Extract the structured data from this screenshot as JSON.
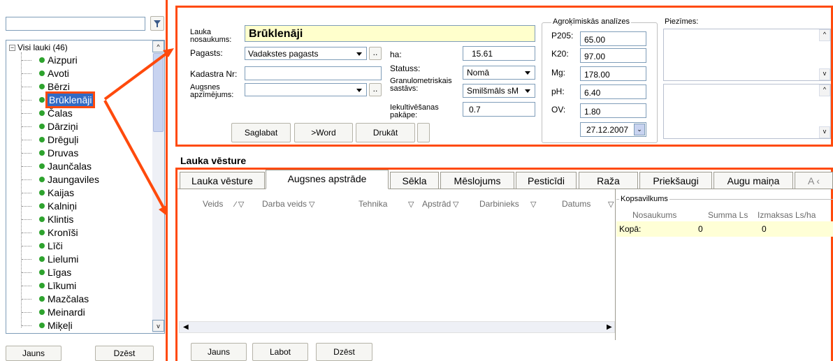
{
  "tree": {
    "filter_icon": "filter-icon",
    "root_label": "Visi lauki (46)",
    "items": [
      "Aizpuri",
      "Avoti",
      "Bērzi",
      "Brūklenāji",
      "Čalas",
      "Dārziņi",
      "Drēguļi",
      "Druvas",
      "Jaunčalas",
      "Jaungaviles",
      "Kaijas",
      "Kalniņi",
      "Klintis",
      "Kronīši",
      "Līči",
      "Lielumi",
      "Līgas",
      "Līkumi",
      "Mazčalas",
      "Meinardi",
      "Miķeļi"
    ],
    "selected_index": 3,
    "new_button": "Jauns",
    "delete_button": "Dzēst"
  },
  "field_form": {
    "name_label": "Lauka nosaukums:",
    "name_value": "Brūklenāji",
    "parish_label": "Pagasts:",
    "parish_value": "Vadakstes pagasts",
    "cadastre_label": "Kadastra Nr:",
    "cadastre_value": "",
    "soil_label": "Augsnes apzīmējums:",
    "soil_value": "",
    "ellipsis": "..",
    "ha_label": "ha:",
    "ha_value": "15.61",
    "status_label": "Statuss:",
    "status_value": "Nomā",
    "granulo_label": "Granulometriskais sastāvs:",
    "granulo_value": "Smilšmāls sM",
    "cultivation_label": "Iekultivēšanas pakāpe:",
    "cultivation_value": "0.7",
    "save_button": "Saglabat",
    "word_button": ">Word",
    "print_button": "Drukāt"
  },
  "agro": {
    "legend": "Agroķīmiskās analīzes",
    "p205_label": "P205:",
    "p205_value": "65.00",
    "k20_label": "K20:",
    "k20_value": "97.00",
    "mg_label": "Mg:",
    "mg_value": "178.00",
    "ph_label": "pH:",
    "ph_value": "6.40",
    "ov_label": "OV:",
    "ov_value": "1.80",
    "date_value": "27.12.2007"
  },
  "notes": {
    "label": "Piezīmes:"
  },
  "history": {
    "title": "Lauka vēsture",
    "tabs": [
      "Lauka vēsture",
      "Augsnes apstrāde",
      "Sēkla",
      "Mēslojums",
      "Pesticīdi",
      "Raža",
      "Priekšaugi",
      "Augu maiņa"
    ],
    "active_tab": 1,
    "columns": [
      "Veids",
      "Darba veids",
      "Tehnika",
      "Apstrād",
      "Darbinieks",
      "Datums"
    ],
    "summary_legend": "Kopsavilkums",
    "summary_columns": [
      "Nosaukums",
      "Summa Ls",
      "Izmaksas Ls/ha"
    ],
    "summary_row": [
      "Kopā:",
      "0",
      "0"
    ],
    "new_button": "Jauns",
    "edit_button": "Labot",
    "delete_button": "Dzēst"
  },
  "colors": {
    "highlight": "#ff4a0c",
    "name_bg": "#ffffcc",
    "summary_bg": "#ffffd6",
    "selected_bg": "#316ac5"
  }
}
